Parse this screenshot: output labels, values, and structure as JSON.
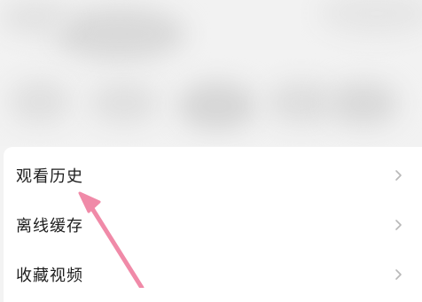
{
  "menu": {
    "items": [
      {
        "label": "观看历史",
        "icon": "chevron-right-icon"
      },
      {
        "label": "离线缓存",
        "icon": "chevron-right-icon"
      },
      {
        "label": "收藏视频",
        "icon": "chevron-right-icon"
      }
    ]
  },
  "annotation": {
    "arrow_color": "#f08aa8",
    "icon": "arrow-pointer-icon"
  }
}
